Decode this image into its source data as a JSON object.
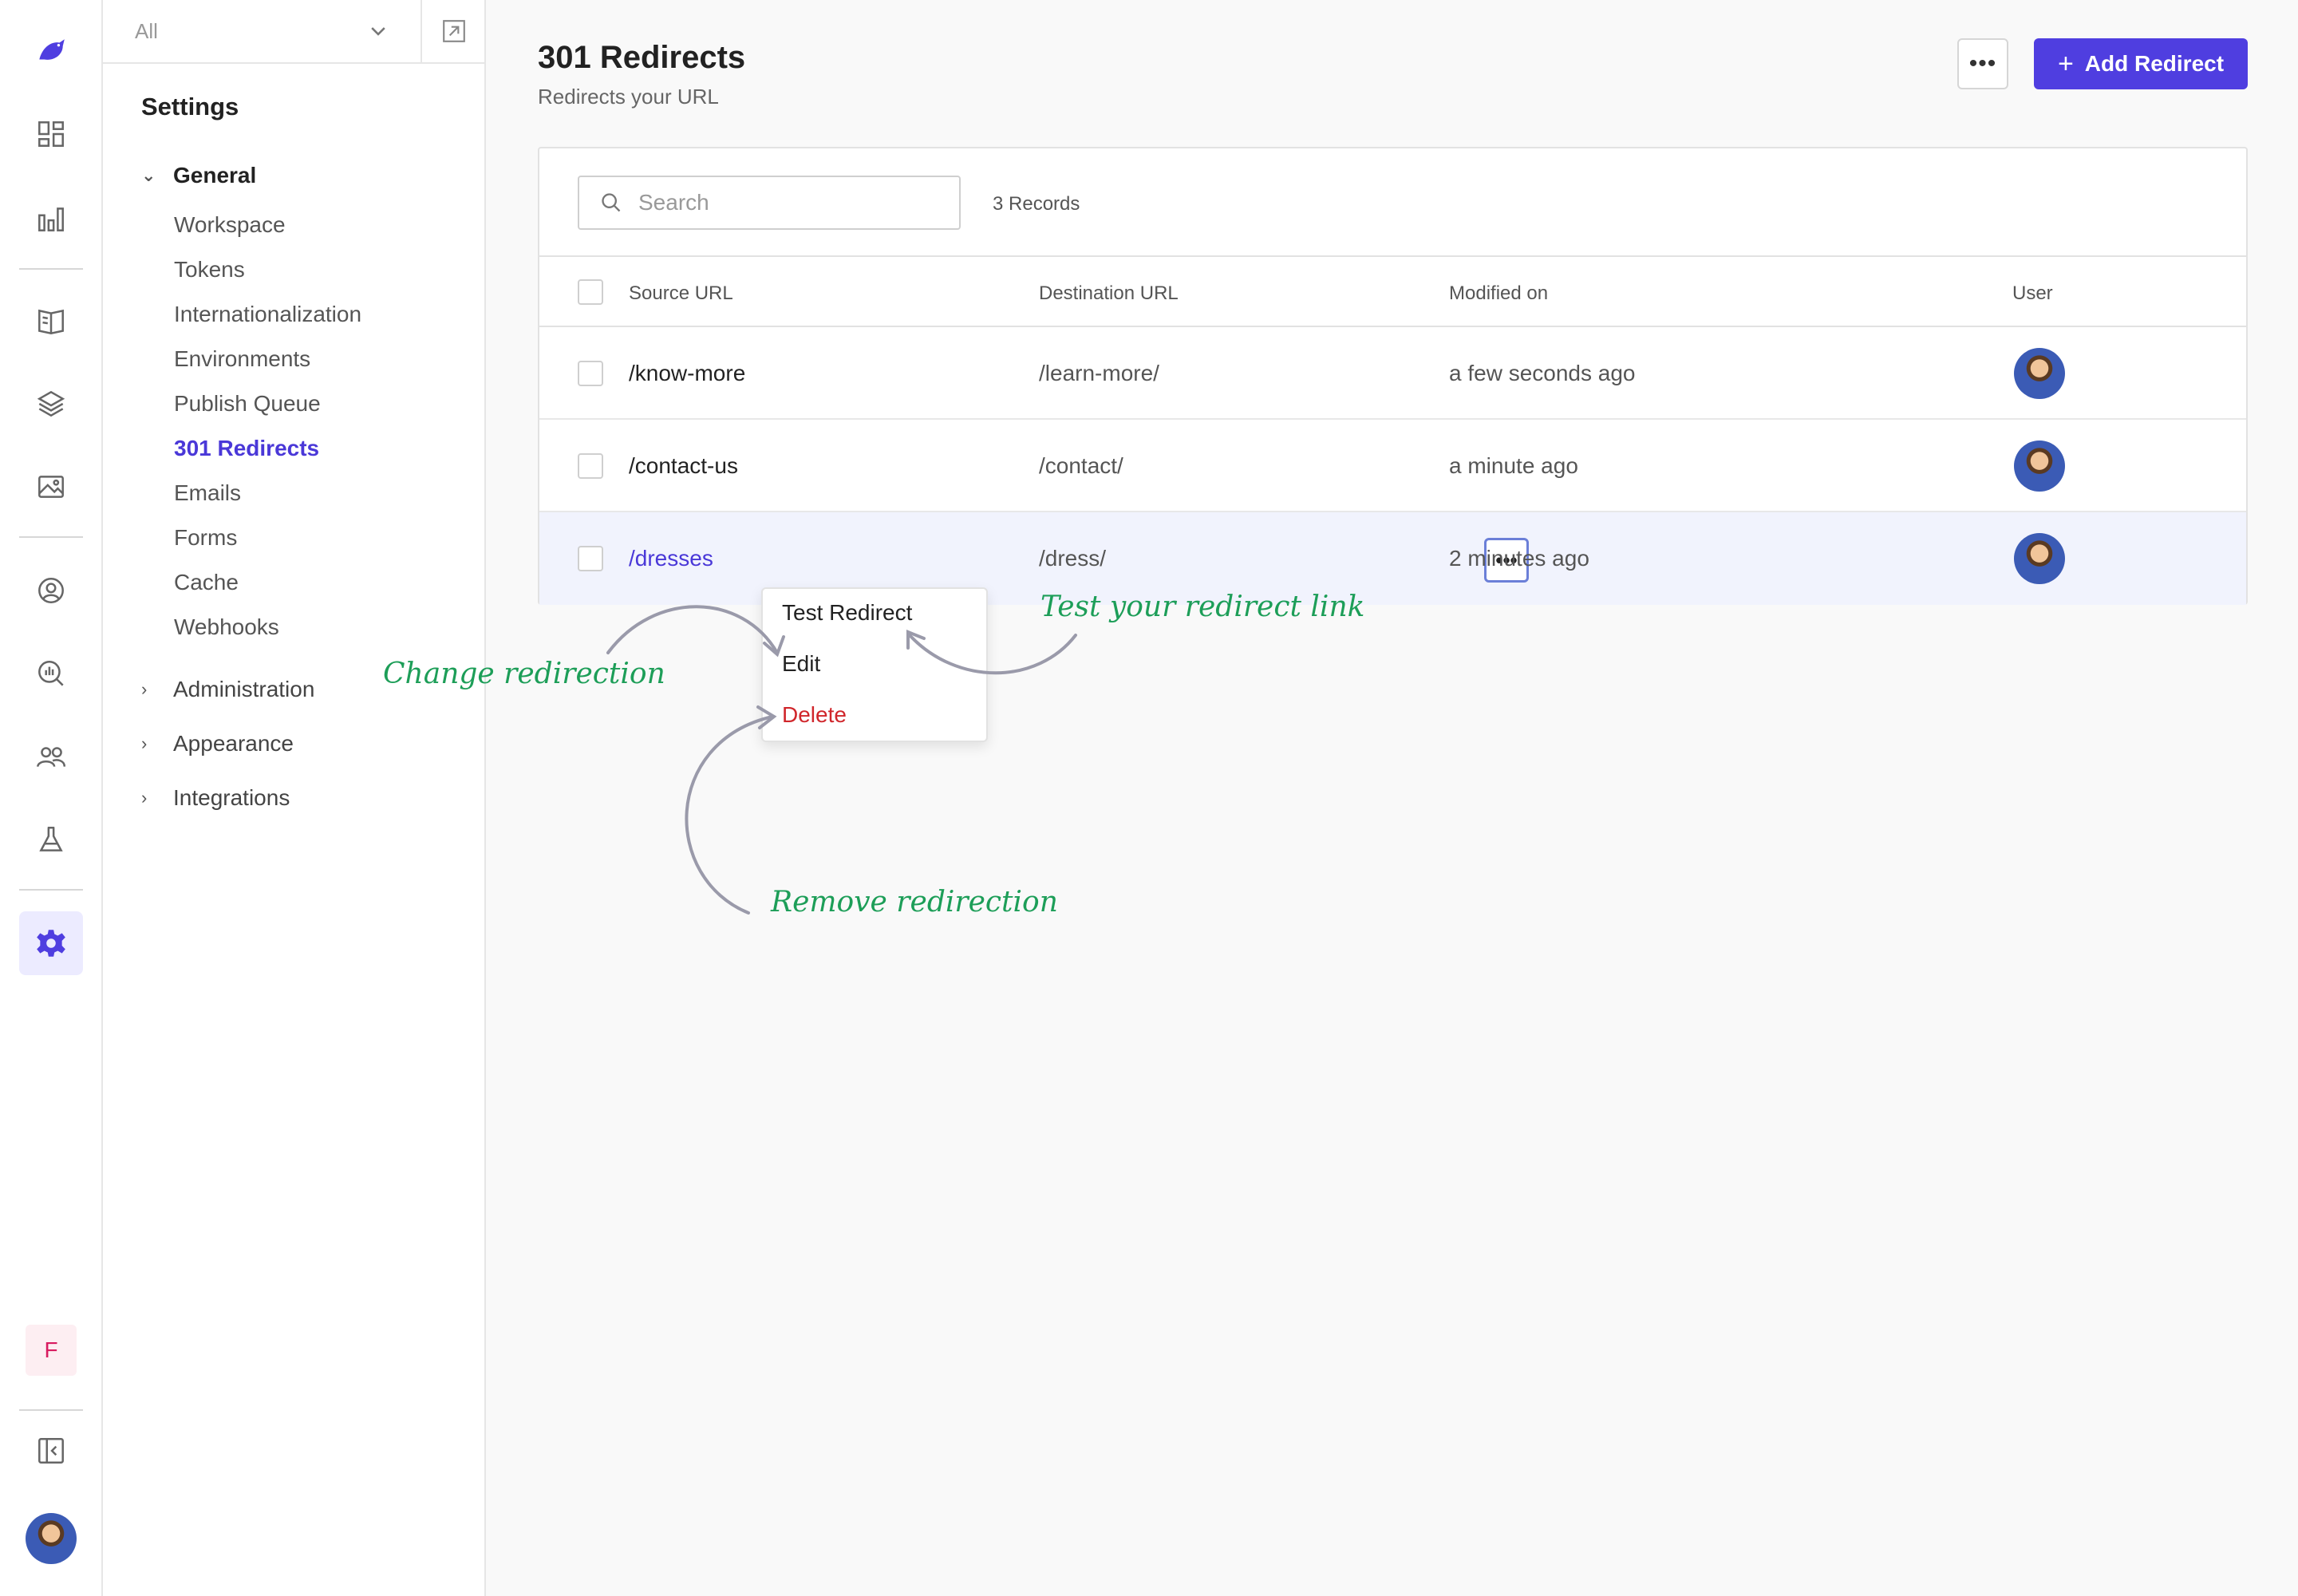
{
  "stack_selector": {
    "value": "All"
  },
  "settings": {
    "title": "Settings",
    "groups": {
      "general": {
        "label": "General",
        "items": [
          "Workspace",
          "Tokens",
          "Internationalization",
          "Environments",
          "Publish Queue",
          "301 Redirects",
          "Emails",
          "Forms",
          "Cache",
          "Webhooks"
        ],
        "active": "301 Redirects"
      },
      "administration": {
        "label": "Administration"
      },
      "appearance": {
        "label": "Appearance"
      },
      "integrations": {
        "label": "Integrations"
      }
    }
  },
  "rail": {
    "icons": [
      "dashboard-icon",
      "analytics-icon",
      "content-icon",
      "stack-icon",
      "assets-icon",
      "users-icon",
      "audit-icon",
      "team-icon",
      "labs-icon",
      "settings-icon"
    ],
    "org_initial": "F"
  },
  "page": {
    "title": "301 Redirects",
    "subtitle": "Redirects your URL",
    "more_label": "•••",
    "add_button": "Add Redirect"
  },
  "table": {
    "search_placeholder": "Search",
    "records": "3 Records",
    "columns": {
      "source": "Source URL",
      "destination": "Destination URL",
      "modified": "Modified on",
      "user": "User"
    },
    "rows": [
      {
        "source": "/know-more",
        "destination": "/learn-more/",
        "modified": "a few seconds ago"
      },
      {
        "source": "/contact-us",
        "destination": "/contact/",
        "modified": "a minute ago"
      },
      {
        "source": "/dresses",
        "destination": "/dress/",
        "modified": "2 minutes ago"
      }
    ],
    "row_menu_label": "•••"
  },
  "row_menu": {
    "items": [
      "Test Redirect",
      "Edit",
      "Delete"
    ]
  },
  "annotations": {
    "change": "Change redirection",
    "test": "Test your redirect link",
    "remove": "Remove redirection"
  },
  "colors": {
    "accent": "#4f3ee0",
    "danger": "#d0262b",
    "annotation": "#1d9e58"
  }
}
